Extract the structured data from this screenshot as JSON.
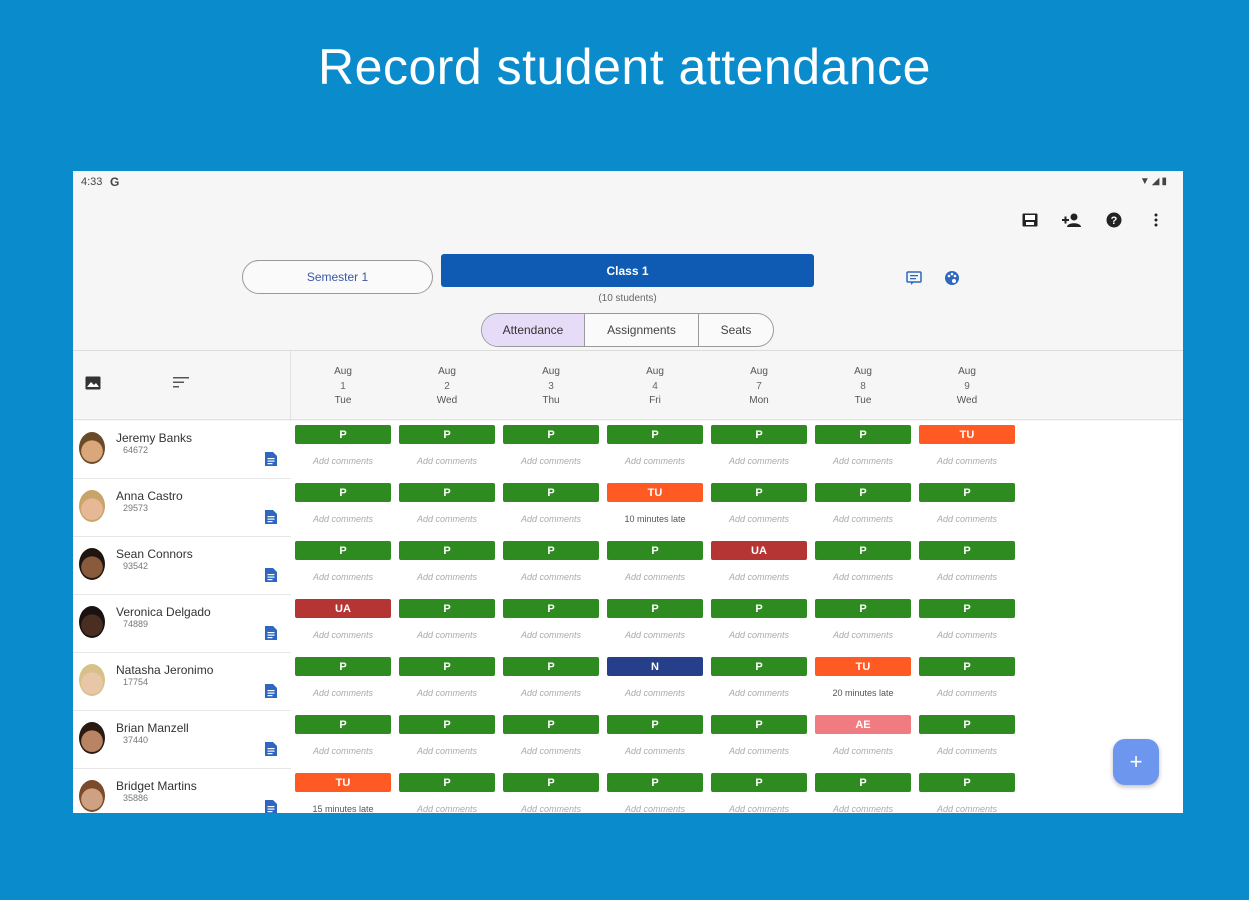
{
  "headline": "Record student attendance",
  "status_bar": {
    "time": "4:33",
    "g_logo": "G",
    "system_icons": "▼◢▮"
  },
  "toolbar": {
    "icons": [
      "save-icon",
      "add-person-icon",
      "help-icon",
      "more-vert-icon"
    ]
  },
  "semester_label": "Semester 1",
  "class_label": "Class 1",
  "class_count": "(10 students)",
  "tabs": [
    {
      "label": "Attendance",
      "active": true
    },
    {
      "label": "Assignments",
      "active": false
    },
    {
      "label": "Seats",
      "active": false
    }
  ],
  "dates": [
    {
      "month": "Aug",
      "day": "1",
      "weekday": "Tue"
    },
    {
      "month": "Aug",
      "day": "2",
      "weekday": "Wed"
    },
    {
      "month": "Aug",
      "day": "3",
      "weekday": "Thu"
    },
    {
      "month": "Aug",
      "day": "4",
      "weekday": "Fri"
    },
    {
      "month": "Aug",
      "day": "7",
      "weekday": "Mon"
    },
    {
      "month": "Aug",
      "day": "8",
      "weekday": "Tue"
    },
    {
      "month": "Aug",
      "day": "9",
      "weekday": "Wed"
    }
  ],
  "status_colors": {
    "P": "#2e8b1f",
    "TU": "#ff5a24",
    "UA": "#b53535",
    "N": "#263f8a",
    "AE": "#f07b80"
  },
  "comment_placeholder": "Add comments",
  "students": [
    {
      "name": "Jeremy Banks",
      "id": "64672",
      "marks": [
        "P",
        "P",
        "P",
        "P",
        "P",
        "P",
        "TU"
      ],
      "comments": [
        "",
        "",
        "",
        "",
        "",
        "",
        ""
      ]
    },
    {
      "name": "Anna Castro",
      "id": "29573",
      "marks": [
        "P",
        "P",
        "P",
        "TU",
        "P",
        "P",
        "P"
      ],
      "comments": [
        "",
        "",
        "",
        "10 minutes late",
        "",
        "",
        ""
      ]
    },
    {
      "name": "Sean Connors",
      "id": "93542",
      "marks": [
        "P",
        "P",
        "P",
        "P",
        "UA",
        "P",
        "P"
      ],
      "comments": [
        "",
        "",
        "",
        "",
        "",
        "",
        ""
      ]
    },
    {
      "name": "Veronica Delgado",
      "id": "74889",
      "marks": [
        "UA",
        "P",
        "P",
        "P",
        "P",
        "P",
        "P"
      ],
      "comments": [
        "",
        "",
        "",
        "",
        "",
        "",
        ""
      ]
    },
    {
      "name": "Natasha Jeronimo",
      "id": "17754",
      "marks": [
        "P",
        "P",
        "P",
        "N",
        "P",
        "TU",
        "P"
      ],
      "comments": [
        "",
        "",
        "",
        "",
        "",
        "20 minutes late",
        ""
      ]
    },
    {
      "name": "Brian Manzell",
      "id": "37440",
      "marks": [
        "P",
        "P",
        "P",
        "P",
        "P",
        "AE",
        "P"
      ],
      "comments": [
        "",
        "",
        "",
        "",
        "",
        "",
        ""
      ]
    },
    {
      "name": "Bridget Martins",
      "id": "35886",
      "marks": [
        "TU",
        "P",
        "P",
        "P",
        "P",
        "P",
        "P"
      ],
      "comments": [
        "15 minutes late",
        "",
        "",
        "",
        "",
        "",
        ""
      ]
    }
  ],
  "fab_label": "+"
}
